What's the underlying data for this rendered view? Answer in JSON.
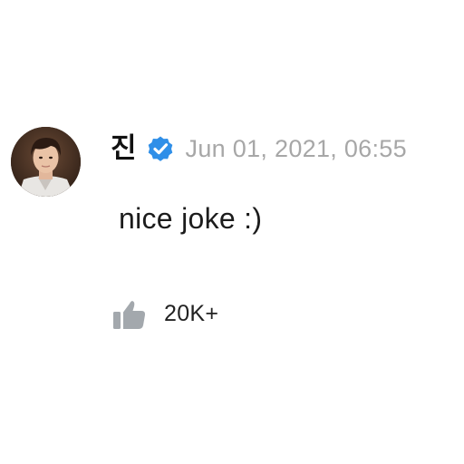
{
  "comment": {
    "author": {
      "name": "진",
      "verified": true,
      "avatar_icon": "profile-photo-avatar"
    },
    "timestamp": "Jun 01, 2021, 06:55",
    "text": "nice joke :)",
    "likes": {
      "icon": "thumbs-up-icon",
      "count_label": "20K+"
    }
  },
  "colors": {
    "verified_badge": "#2f8fe8",
    "timestamp": "#a7a7a7",
    "like_icon": "#a3a8ad",
    "text": "#1c1c1c"
  }
}
